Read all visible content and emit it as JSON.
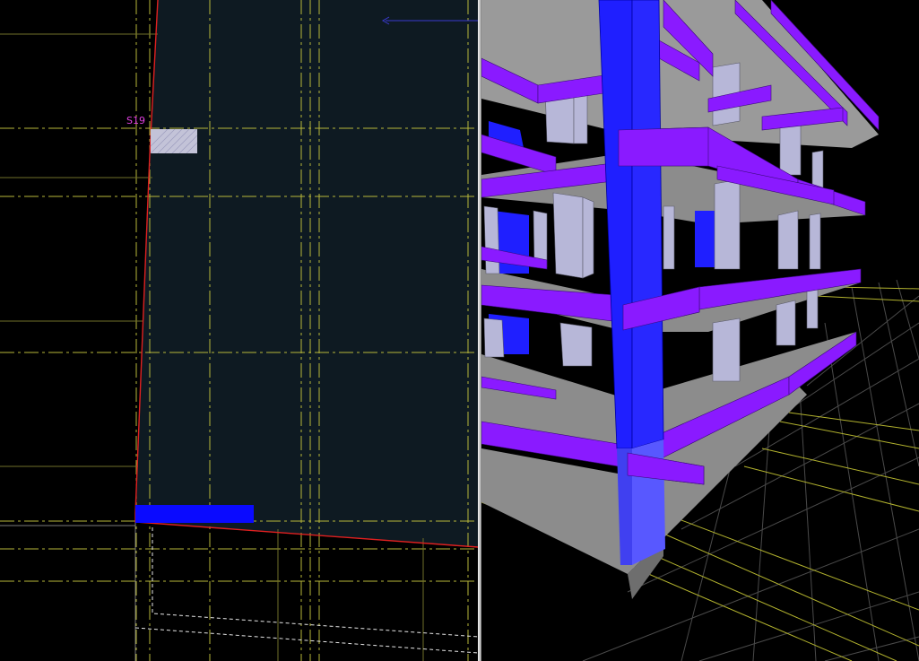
{
  "plan_view": {
    "column_tag": "S19",
    "colors": {
      "background": "#000000",
      "slab_fill": "#0e1a22",
      "grid_line": "#b8b83a",
      "slab_edge": "#e02020",
      "column_fill": "#c3c3d8",
      "beam_fill": "#0a0aff",
      "tag_text": "#e040e0",
      "dimension_arrow": "#3b3bd0"
    }
  },
  "view_3d": {
    "colors": {
      "slab": "#8c8c8c",
      "beam": "#8a1aff",
      "column": "#b7b7d8",
      "highlighted_column": "#1f1fff",
      "highlighted_column_lower": "#5858ff",
      "grid": "#b3b32e",
      "ground_grid": "#5a5a5a"
    }
  }
}
